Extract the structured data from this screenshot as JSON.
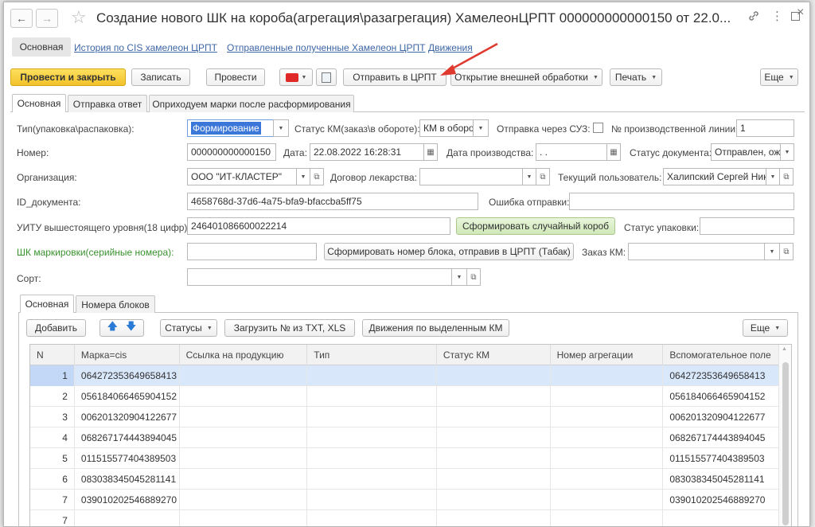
{
  "window": {
    "title": "Создание нового ШК на короба(агрегация\\разагрегация) ХамелеонЦРПТ 000000000000150 от 22.0..."
  },
  "icons": {
    "back": "arrow-left-icon",
    "forward": "arrow-right-icon",
    "favorite": "star-icon",
    "link": "link-icon",
    "more": "vertical-dots-icon",
    "maximize": "maximize-icon",
    "close": "close-icon"
  },
  "nav": {
    "main": "Основная",
    "history": "История по CIS хамелеон ЦРПТ",
    "sent": "Отправленные полученные Хамелеон ЦРПТ",
    "movements": "Движения"
  },
  "toolbar": {
    "post_close": "Провести и закрыть",
    "save": "Записать",
    "post": "Провести",
    "send_crpt": "Отправить в ЦРПТ",
    "open_processing": "Открытие внешней обработки",
    "print": "Печать",
    "more": "Еще"
  },
  "tabs": [
    "Основная",
    "Отправка ответ",
    "Оприходуем марки после расформирования"
  ],
  "form": {
    "pack_type_label": "Тип(упаковка\\распаковка):",
    "pack_type_value": "Формирование",
    "km_status_label": "Статус КМ(заказ\\в обороте):",
    "km_status_value": "КМ в оборот",
    "suz_label": "Отправка через СУЗ:",
    "line_label": "№ производственной линии:",
    "line_value": "1",
    "number_label": "Номер:",
    "number_value": "000000000000150",
    "date_label": "Дата:",
    "date_value": "22.08.2022 16:28:31",
    "prod_date_label": "Дата производства:",
    "prod_date_value": " .  .",
    "doc_status_label": "Статус документа:",
    "doc_status_value": "Отправлен, ож",
    "org_label": "Организация:",
    "org_value": "ООО \"ИТ-КЛАСТЕР\"",
    "contract_label": "Договор лекарства:",
    "contract_value": "",
    "user_label": "Текущий пользователь:",
    "user_value": "Халипский Сергей Ник",
    "doc_id_label": "ID_документа:",
    "doc_id_value": "4658768d-37d6-4a75-bfa9-bfaccba5ff75",
    "error_label": "Ошибка отправки:",
    "error_value": "",
    "sscc_label": "УИТУ вышестоящего уровня(18 цифр):",
    "sscc_value": "246401086600022214",
    "random_box_btn": "Сформировать случайный короб",
    "pack_status_label": "Статус упаковки:",
    "pack_status_value": "",
    "barcode_label": "ШК маркировки(серийные номера):",
    "barcode_value": "",
    "block_number_btn": "Сформировать номер блока, отправив в ЦРПТ (Табак)",
    "order_km_label": "Заказ КМ:",
    "order_km_value": "",
    "sort_label": "Сорт:",
    "sort_value": ""
  },
  "inner_tabs": [
    "Основная",
    "Номера блоков"
  ],
  "table_toolbar": {
    "add": "Добавить",
    "statuses": "Статусы",
    "load": "Загрузить № из TXT, XLS",
    "movements": "Движения по выделенным КМ",
    "more": "Еще"
  },
  "table": {
    "columns": [
      "N",
      "Марка=cis",
      "Ссылка на продукцию",
      "Тип",
      "Статус КМ",
      "Номер агрегации",
      "Вспомогательное поле"
    ],
    "rows": [
      [
        "1",
        "064272353649658413",
        "",
        "",
        "",
        "",
        "064272353649658413"
      ],
      [
        "2",
        "056184066465904152",
        "",
        "",
        "",
        "",
        "056184066465904152"
      ],
      [
        "3",
        "006201320904122677",
        "",
        "",
        "",
        "",
        "006201320904122677"
      ],
      [
        "4",
        "068267174443894045",
        "",
        "",
        "",
        "",
        "068267174443894045"
      ],
      [
        "5",
        "011515577404389503",
        "",
        "",
        "",
        "",
        "011515577404389503"
      ],
      [
        "6",
        "083038345045281141",
        "",
        "",
        "",
        "",
        "083038345045281141"
      ],
      [
        "7",
        "039010202546889270",
        "",
        "",
        "",
        "",
        "039010202546889270"
      ],
      [
        "7",
        "",
        "",
        "",
        "",
        "",
        ""
      ]
    ]
  },
  "colors": {
    "accent_button": "#f2c22a",
    "green_button": "#cfe8b8",
    "link": "#3d66a5",
    "selection": "#3b77d9",
    "arrow": "#e03a2f"
  }
}
